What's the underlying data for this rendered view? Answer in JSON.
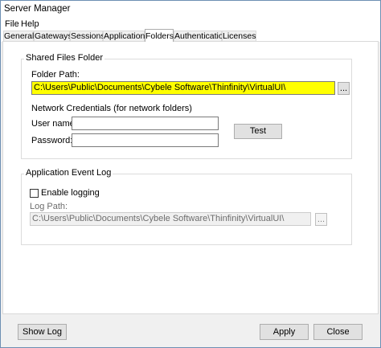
{
  "window": {
    "title": "Server Manager"
  },
  "menu": {
    "file": "File",
    "help": "Help"
  },
  "tabs": [
    {
      "label": "General"
    },
    {
      "label": "Gateways"
    },
    {
      "label": "Sessions"
    },
    {
      "label": "Applications"
    },
    {
      "label": "Folders"
    },
    {
      "label": "Authentication"
    },
    {
      "label": "Licenses"
    }
  ],
  "shared_folder": {
    "title": "Shared Files Folder",
    "folder_path_label": "Folder Path:",
    "folder_path_value": "C:\\Users\\Public\\Documents\\Cybele Software\\Thinfinity\\VirtualUI\\",
    "browse_label": "...",
    "network_credentials_label": "Network Credentials (for network folders)",
    "username_label": "User name:",
    "username_value": "",
    "password_label": "Password:",
    "password_value": "",
    "test_label": "Test"
  },
  "event_log": {
    "title": "Application Event Log",
    "enable_logging_label": "Enable logging",
    "enable_logging_checked": false,
    "log_path_label": "Log Path:",
    "log_path_value": "C:\\Users\\Public\\Documents\\Cybele Software\\Thinfinity\\VirtualUI\\",
    "browse_label": "..."
  },
  "footer": {
    "show_log": "Show Log",
    "apply": "Apply",
    "close": "Close"
  },
  "colors": {
    "folder_path_highlight": "#ffff00",
    "window_border": "#6d8fb3"
  }
}
